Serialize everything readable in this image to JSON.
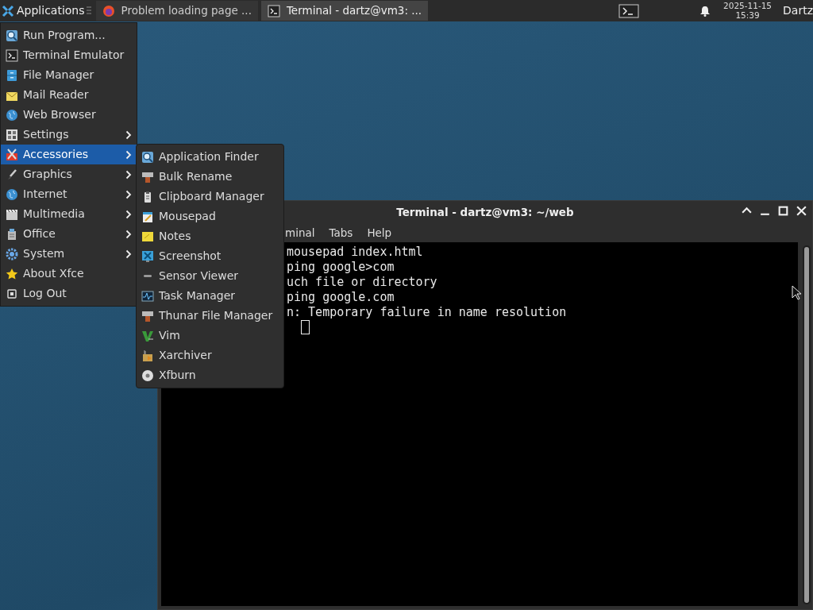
{
  "panel": {
    "applications": "Applications",
    "tasks": [
      {
        "label": "Problem loading page ...",
        "kind": "browser",
        "selected": false
      },
      {
        "label": "Terminal - dartz@vm3: ...",
        "kind": "terminal",
        "selected": true
      }
    ],
    "clock": {
      "date": "2025-11-15",
      "time": "15:39"
    },
    "user": "Dartz"
  },
  "menu": {
    "items": [
      {
        "label": "Run Program...",
        "kind": "search",
        "submenu": false,
        "selected": false
      },
      {
        "label": "Terminal Emulator",
        "kind": "terminal",
        "submenu": false,
        "selected": false
      },
      {
        "label": "File Manager",
        "kind": "file",
        "submenu": false,
        "selected": false
      },
      {
        "label": "Mail Reader",
        "kind": "mail",
        "submenu": false,
        "selected": false
      },
      {
        "label": "Web Browser",
        "kind": "globe",
        "submenu": false,
        "selected": false
      },
      {
        "label": "Settings",
        "kind": "settings",
        "submenu": true,
        "selected": false
      },
      {
        "label": "Accessories",
        "kind": "tools",
        "submenu": true,
        "selected": true
      },
      {
        "label": "Graphics",
        "kind": "brush",
        "submenu": true,
        "selected": false
      },
      {
        "label": "Internet",
        "kind": "globe",
        "submenu": true,
        "selected": false
      },
      {
        "label": "Multimedia",
        "kind": "film",
        "submenu": true,
        "selected": false
      },
      {
        "label": "Office",
        "kind": "office",
        "submenu": true,
        "selected": false
      },
      {
        "label": "System",
        "kind": "gear",
        "submenu": true,
        "selected": false
      },
      {
        "label": "About Xfce",
        "kind": "star",
        "submenu": false,
        "selected": false
      },
      {
        "label": "Log Out",
        "kind": "logout",
        "submenu": false,
        "selected": false
      }
    ]
  },
  "submenu": {
    "items": [
      {
        "label": "Application Finder",
        "kind": "search"
      },
      {
        "label": "Bulk Rename",
        "kind": "rename"
      },
      {
        "label": "Clipboard Manager",
        "kind": "clipboard"
      },
      {
        "label": "Mousepad",
        "kind": "editor"
      },
      {
        "label": "Notes",
        "kind": "notes"
      },
      {
        "label": "Screenshot",
        "kind": "screenshot"
      },
      {
        "label": "Sensor Viewer",
        "kind": "sensor"
      },
      {
        "label": "Task Manager",
        "kind": "monitor"
      },
      {
        "label": "Thunar File Manager",
        "kind": "rename"
      },
      {
        "label": "Vim",
        "kind": "vim"
      },
      {
        "label": "Xarchiver",
        "kind": "archive"
      },
      {
        "label": "Xfburn",
        "kind": "disc"
      }
    ]
  },
  "terminal": {
    "title": "Terminal - dartz@vm3: ~/web",
    "menus": [
      "minal",
      "Tabs",
      "Help"
    ],
    "lines": [
      "mousepad index.html",
      "ping google>com",
      "uch file or directory",
      "ping google.com",
      "n: Temporary failure in name resolution"
    ]
  }
}
